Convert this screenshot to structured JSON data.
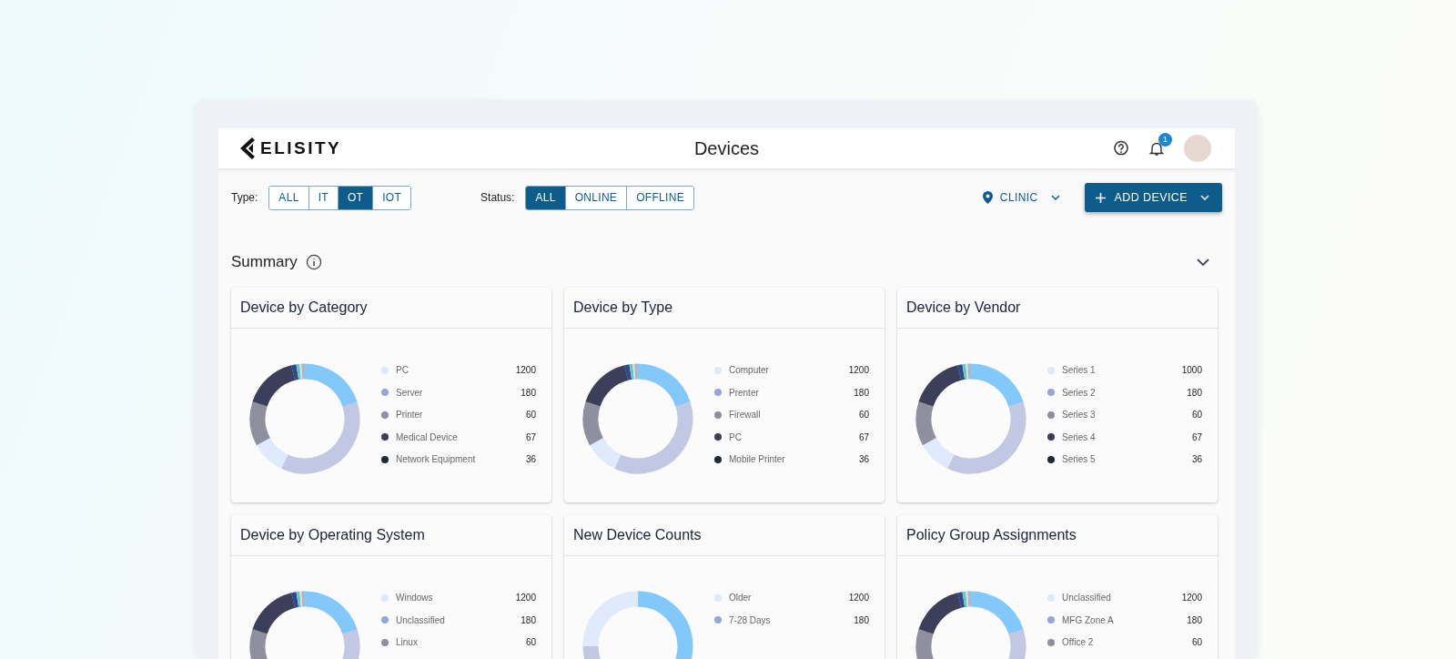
{
  "header": {
    "logo": "ELISITY",
    "title": "Devices",
    "notifications": "1"
  },
  "filters": {
    "type": {
      "label": "Type:",
      "options": [
        {
          "label": "ALL",
          "selected": false
        },
        {
          "label": "IT",
          "selected": false
        },
        {
          "label": "OT",
          "selected": true
        },
        {
          "label": "IOT",
          "selected": false
        }
      ]
    },
    "status": {
      "label": "Status:",
      "options": [
        {
          "label": "ALL",
          "selected": true
        },
        {
          "label": "ONLINE",
          "selected": false
        },
        {
          "label": "OFFLINE",
          "selected": false
        }
      ]
    },
    "location": "CLINIC",
    "add_button": "ADD DEVICE"
  },
  "summary": {
    "title": "Summary"
  },
  "cards": [
    {
      "title": "Device by Category",
      "kind": "standard",
      "legend": [
        {
          "label": "PC",
          "value": "1200",
          "color": "#dde9fb"
        },
        {
          "label": "Server",
          "value": "180",
          "color": "#93a8d6"
        },
        {
          "label": "Printer",
          "value": "60",
          "color": "#8e8e9e"
        },
        {
          "label": "Medical Device",
          "value": "67",
          "color": "#3c3e58"
        },
        {
          "label": "Network Equipment",
          "value": "36",
          "color": "#1c2b33"
        }
      ]
    },
    {
      "title": "Device by Type",
      "kind": "standard",
      "legend": [
        {
          "label": "Computer",
          "value": "1200",
          "color": "#dde9fb"
        },
        {
          "label": "Prenter",
          "value": "180",
          "color": "#93a8d6"
        },
        {
          "label": "Firewall",
          "value": "60",
          "color": "#8e8e9e"
        },
        {
          "label": "PC",
          "value": "67",
          "color": "#3c3e58"
        },
        {
          "label": "Mobile Printer",
          "value": "36",
          "color": "#1c2b33"
        }
      ]
    },
    {
      "title": "Device by Vendor",
      "kind": "standard",
      "legend": [
        {
          "label": "Series 1",
          "value": "1000",
          "color": "#dde9fb"
        },
        {
          "label": "Series 2",
          "value": "180",
          "color": "#93a8d6"
        },
        {
          "label": "Series 3",
          "value": "60",
          "color": "#8e8e9e"
        },
        {
          "label": "Series 4",
          "value": "67",
          "color": "#3c3e58"
        },
        {
          "label": "Series 5",
          "value": "36",
          "color": "#1c2b33"
        }
      ]
    },
    {
      "title": "Device by Operating System",
      "kind": "standard",
      "legend": [
        {
          "label": "Windows",
          "value": "1200",
          "color": "#dde9fb"
        },
        {
          "label": "Unclassified",
          "value": "180",
          "color": "#93a8d6"
        },
        {
          "label": "Linux",
          "value": "60",
          "color": "#8e8e9e"
        }
      ]
    },
    {
      "title": "New Device Counts",
      "kind": "halves",
      "legend": [
        {
          "label": "Older",
          "value": "1200",
          "color": "#dde9fb"
        },
        {
          "label": "7-28 Days",
          "value": "180",
          "color": "#93a8d6"
        }
      ]
    },
    {
      "title": "Policy Group Assignments",
      "kind": "standard",
      "legend": [
        {
          "label": "Unclassified",
          "value": "1200",
          "color": "#dde9fb"
        },
        {
          "label": "MFG Zone A",
          "value": "180",
          "color": "#93a8d6"
        },
        {
          "label": "Office 2",
          "value": "60",
          "color": "#8e8e9e"
        }
      ]
    }
  ]
}
